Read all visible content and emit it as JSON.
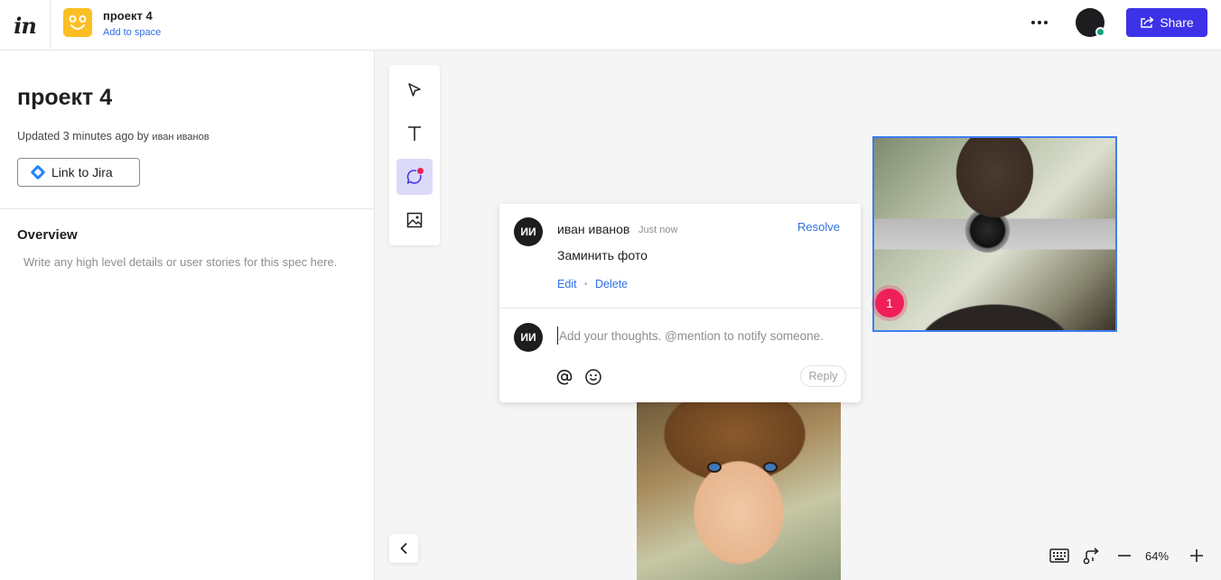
{
  "topbar": {
    "logo": "in",
    "project_name": "проект 4",
    "add_to_space": "Add to space",
    "share_label": "Share",
    "more_icon": "more-horizontal-icon",
    "colors": {
      "share": "#3d32e8",
      "project_icon": "#fbbf24",
      "online": "#14a37f"
    }
  },
  "sidebar": {
    "title": "проект 4",
    "updated_prefix": "Updated 3 minutes ago by",
    "updated_by": "иван иванов",
    "jira_label": "Link to Jira",
    "overview_heading": "Overview",
    "overview_placeholder": "Write any high level details or user stories for this spec here."
  },
  "toolbar": {
    "tools": [
      {
        "name": "select",
        "icon": "cursor-arrow-icon",
        "active": false
      },
      {
        "name": "text",
        "icon": "text-t-icon",
        "active": false
      },
      {
        "name": "comment",
        "icon": "comment-bubble-icon",
        "active": true
      },
      {
        "name": "image",
        "icon": "image-icon",
        "active": false
      }
    ]
  },
  "canvas": {
    "pin_number": "1",
    "comment": {
      "avatar_initials": "ИИ",
      "author": "иван иванов",
      "time": "Just now",
      "resolve_label": "Resolve",
      "text": "Заминить фото",
      "edit_label": "Edit",
      "separator": "•",
      "delete_label": "Delete",
      "reply_avatar_initials": "ИИ",
      "reply_placeholder": "Add your thoughts. @mention to notify someone.",
      "reply_label": "Reply"
    }
  },
  "bottom": {
    "zoom": "64%"
  }
}
